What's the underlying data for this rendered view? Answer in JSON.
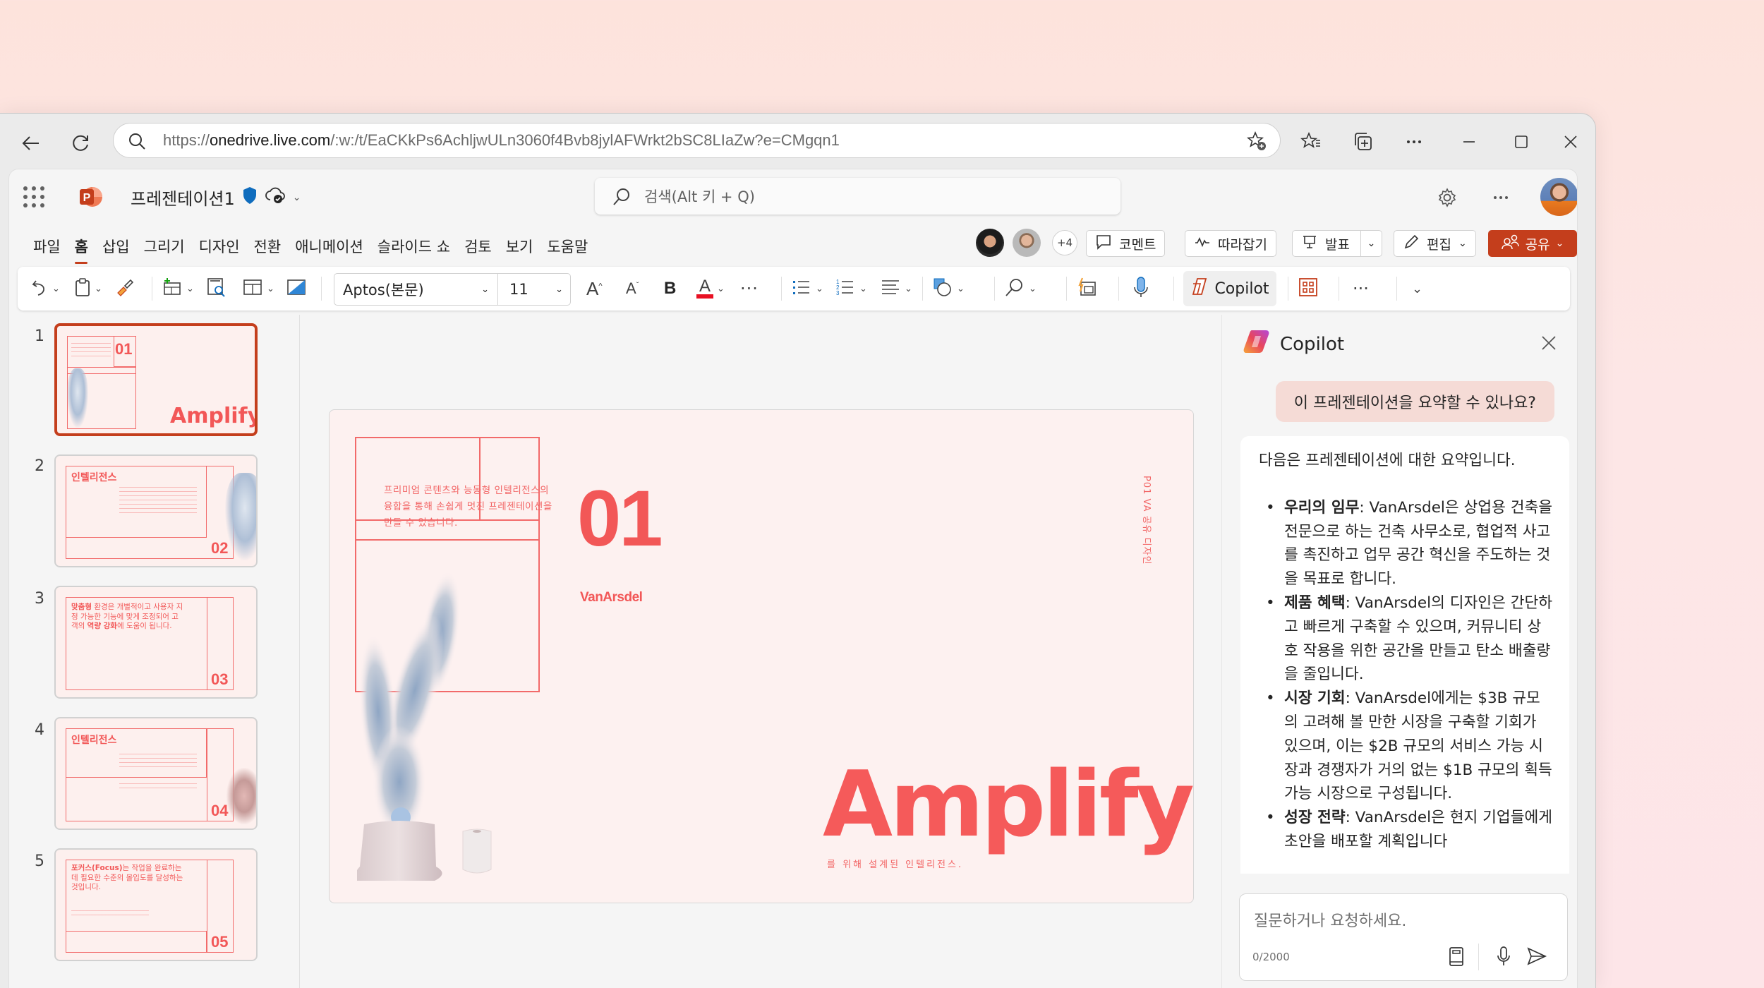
{
  "browser": {
    "url_prefix": "https://",
    "url_host": "onedrive.live.com",
    "url_path": "/:w:/t/EaCKkPs6AchljwULn3060f4Bvb8jylAFWrkt2bSC8LIaZw?e=CMgqn1",
    "icons": [
      "back-icon",
      "refresh-icon",
      "search-icon",
      "add-favorite-icon",
      "favorites-icon",
      "collections-icon",
      "more-icon",
      "minimize-icon",
      "maximize-icon",
      "close-icon"
    ]
  },
  "app": {
    "name": "PowerPoint",
    "doc_title": "프레젠테이션1",
    "search_placeholder": "검색(Alt 키 + Q)",
    "menu": [
      "파일",
      "홈",
      "삽입",
      "그리기",
      "디자인",
      "전환",
      "애니메이션",
      "슬라이드 쇼",
      "검토",
      "보기",
      "도움말"
    ],
    "active_menu": "홈",
    "collaborators_more": "+4",
    "buttons": {
      "comment": "코멘트",
      "catch_up": "따라잡기",
      "present": "발표",
      "edit": "편집",
      "share": "공유"
    },
    "accent": "#c43e1c"
  },
  "ribbon": {
    "font_name": "Aptos(본문)",
    "font_size": "11",
    "bold_label": "B",
    "font_color": "#e81123",
    "copilot_label": "Copilot"
  },
  "thumbnails": [
    {
      "num": "1",
      "title": "Amplify",
      "badge": "01",
      "selected": true
    },
    {
      "num": "2",
      "title": "인텔리전스",
      "badge": "02",
      "selected": false
    },
    {
      "num": "3",
      "body_bold1": "맞춤형",
      "body1": " 환경은 개별적이고 사용자 지정 가능한 기능에 맞게 조정되어 고객의 ",
      "body_bold2": "역량 강화",
      "body2": "에 도움이 됩니다.",
      "badge": "03",
      "selected": false
    },
    {
      "num": "4",
      "title": "인텔리전스",
      "badge": "04",
      "selected": false
    },
    {
      "num": "5",
      "body_bold1": "포커스(Focus)",
      "body1": "는 작업을 완료하는 데 필요한 수준의 몰입도를 달성하는 것입니다.",
      "badge": "05",
      "selected": false
    }
  ],
  "slide": {
    "intro": "프리미엄 콘텐츠와 능동형 인텔리전스의 융합을 통해 손쉽게 멋진 프레젠테이션을 만들 수 있습니다.",
    "number": "01",
    "brand": "VanArsdel",
    "vertical_label": "P01    VA 공유 디자인",
    "title": "Amplify",
    "subtitle": "를 위해 설계된 인텔리전스.",
    "accent": "#f25757",
    "background": "#fdf1f0"
  },
  "copilot": {
    "title": "Copilot",
    "user_prompt": "이 프레젠테이션을 요약할 수 있나요?",
    "answer_intro": "다음은 프레젠테이션에 대한 요약입니다.",
    "bullets": [
      {
        "head": "우리의 임무",
        "text": ": VanArsdel은 상업용 건축을 전문으로 하는 건축 사무소로, 협업적 사고를 촉진하고 업무 공간 혁신을 주도하는 것을 목표로 합니다."
      },
      {
        "head": "제품 혜택",
        "text": ": VanArsdel의 디자인은 간단하고 빠르게 구축할 수 있으며, 커뮤니티 상호 작용을 위한 공간을 만들고 탄소 배출량을 줄입니다."
      },
      {
        "head": "시장 기회",
        "text": ": VanArsdel에게는 $3B 규모의 고려해 볼 만한 시장을 구축할 기회가 있으며, 이는 $2B 규모의 서비스 가능 시장과 경쟁자가 거의 없는 $1B 규모의 획득 가능 시장으로 구성됩니다."
      },
      {
        "head": "성장 전략",
        "text": ": VanArsdel은 현지 기업들에게 초안을 배포할 계획입니다"
      }
    ],
    "input_placeholder": "질문하거나 요청하세요.",
    "char_count": "0/2000"
  }
}
